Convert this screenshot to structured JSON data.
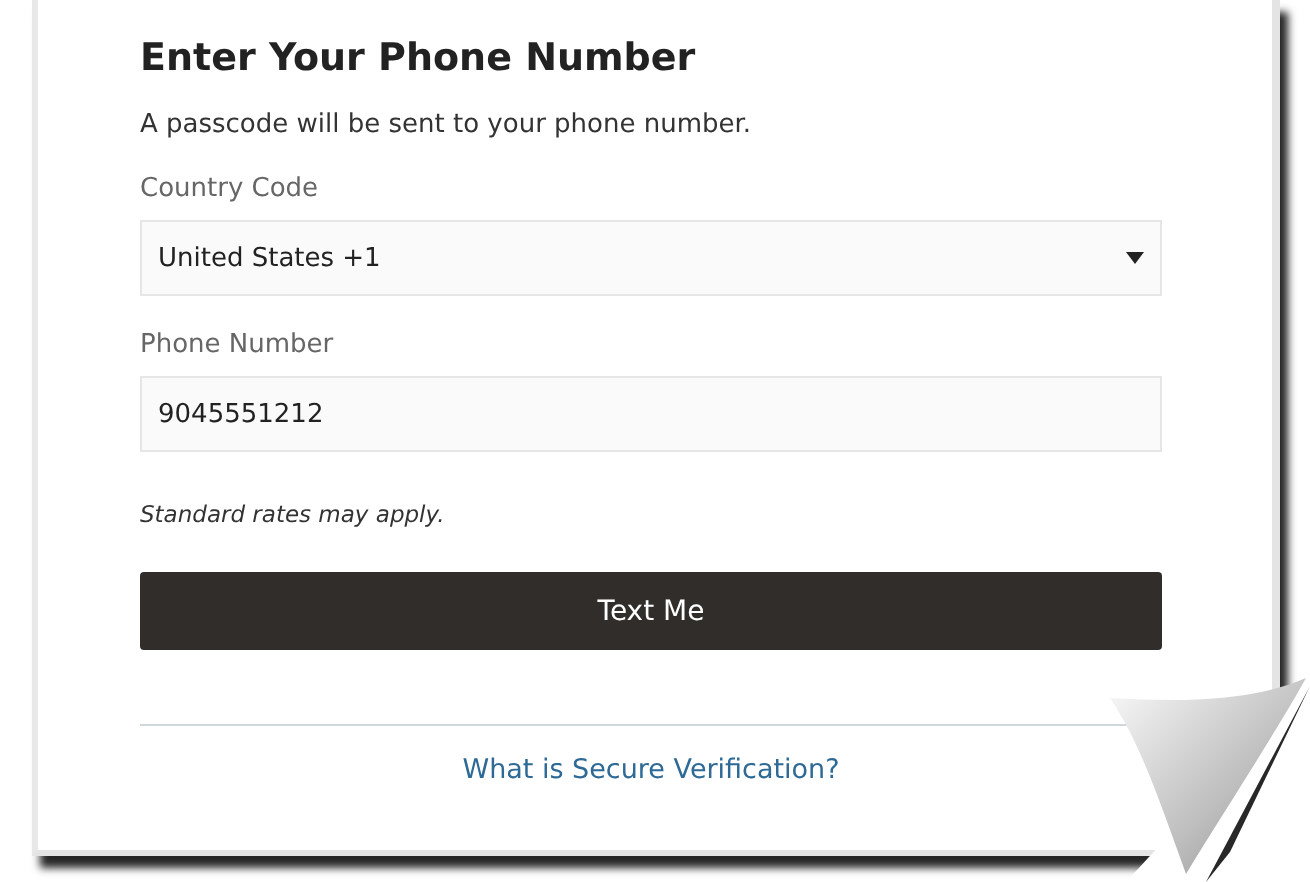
{
  "title": "Enter Your Phone Number",
  "description": "A passcode will be sent to your phone number.",
  "country_code": {
    "label": "Country Code",
    "value": "United States +1"
  },
  "phone_number": {
    "label": "Phone Number",
    "value": "9045551212"
  },
  "note": "Standard rates may apply.",
  "submit_button": "Text Me",
  "help_link": "What is Secure Verification?"
}
